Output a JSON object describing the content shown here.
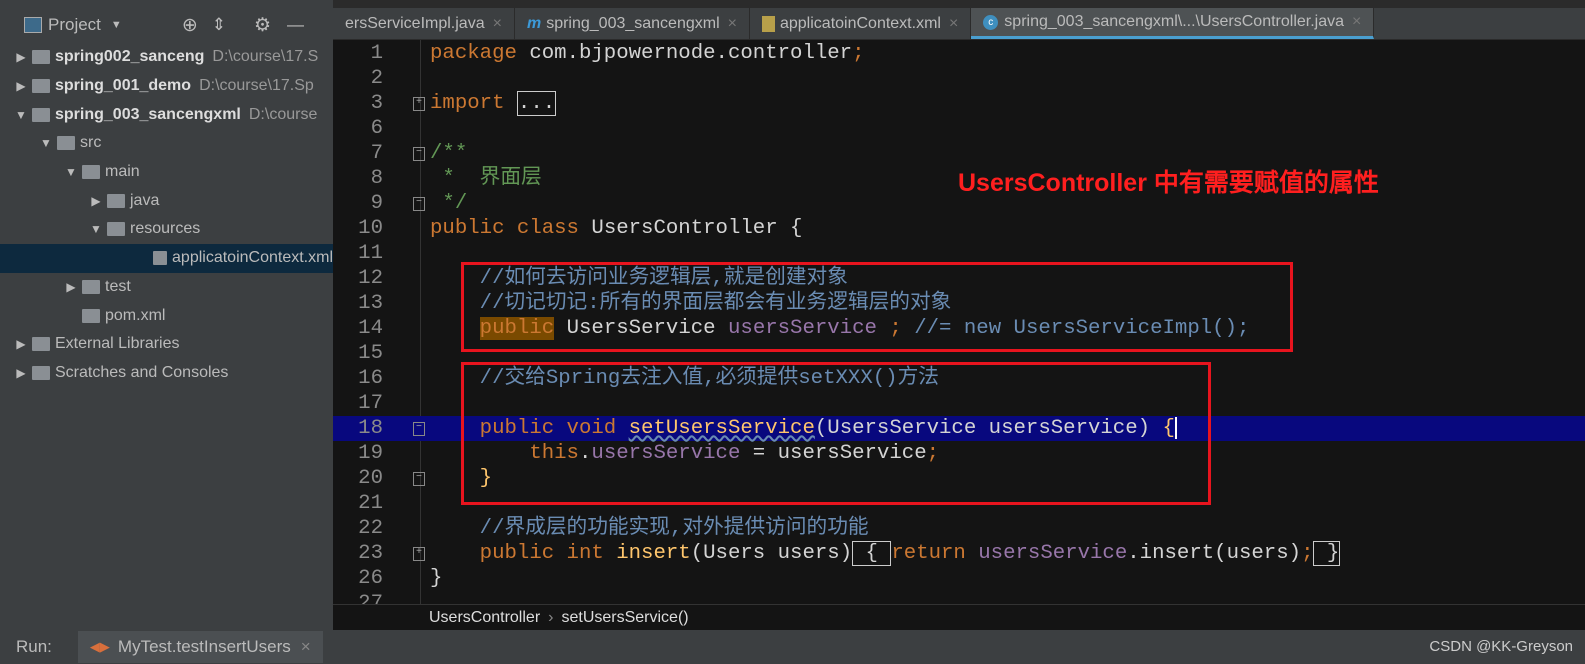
{
  "sidebar": {
    "title": "Project",
    "items": [
      {
        "arrow": "▶",
        "name": "spring002_sanceng",
        "path": "D:\\course\\17.S",
        "bold": true,
        "indent": 0
      },
      {
        "arrow": "▶",
        "name": "spring_001_demo",
        "path": "D:\\course\\17.Sp",
        "bold": true,
        "indent": 0
      },
      {
        "arrow": "▼",
        "name": "spring_003_sancengxml",
        "path": "D:\\course",
        "bold": true,
        "indent": 0
      },
      {
        "arrow": "▼",
        "name": "src",
        "path": "",
        "indent": 1
      },
      {
        "arrow": "▼",
        "name": "main",
        "path": "",
        "indent": 2
      },
      {
        "arrow": "▶",
        "name": "java",
        "path": "",
        "indent": 3
      },
      {
        "arrow": "▼",
        "name": "resources",
        "path": "",
        "indent": 3
      },
      {
        "arrow": "",
        "name": "applicatoinContext.xml",
        "path": "",
        "indent": 5,
        "selected": true
      },
      {
        "arrow": "▶",
        "name": "test",
        "path": "",
        "indent": 2
      },
      {
        "arrow": "",
        "name": "pom.xml",
        "path": "",
        "indent": 2
      },
      {
        "arrow": "▶",
        "name": "External Libraries",
        "path": "",
        "indent": 0
      },
      {
        "arrow": "▶",
        "name": "Scratches and Consoles",
        "path": "",
        "indent": 0
      }
    ]
  },
  "tabs": [
    {
      "label": "ersServiceImpl.java"
    },
    {
      "label": "spring_003_sancengxml",
      "icon": "m"
    },
    {
      "label": "applicatoinContext.xml"
    },
    {
      "label": "spring_003_sancengxml\\...\\UsersController.java",
      "icon": "c",
      "active": true
    }
  ],
  "code": [
    {
      "n": "1",
      "t": [
        [
          "package",
          "kw"
        ],
        [
          " com.bjpowernode.controller",
          "pl"
        ],
        [
          ";",
          "kw"
        ]
      ]
    },
    {
      "n": "2",
      "t": []
    },
    {
      "n": "3",
      "fold": "+",
      "t": [
        [
          "import",
          "kw"
        ],
        [
          " ",
          ""
        ],
        [
          "...",
          "pl box"
        ]
      ]
    },
    {
      "n": "6",
      "t": []
    },
    {
      "n": "7",
      "fold": "-",
      "t": [
        [
          "/**",
          "cm"
        ]
      ]
    },
    {
      "n": "8",
      "t": [
        [
          " *  界面层",
          "cm"
        ]
      ]
    },
    {
      "n": "9",
      "fold": "-",
      "t": [
        [
          " */",
          "cm"
        ]
      ]
    },
    {
      "n": "10",
      "t": [
        [
          "public class",
          "kw"
        ],
        [
          " UsersController {",
          "pl"
        ]
      ]
    },
    {
      "n": "11",
      "t": []
    },
    {
      "n": "12",
      "t": [
        [
          "    //如何去访问业务逻辑层,就是创建对象",
          "cmb"
        ]
      ]
    },
    {
      "n": "13",
      "t": [
        [
          "    //切记切记:所有的界面层都会有业务逻辑层的对象",
          "cmb"
        ]
      ]
    },
    {
      "n": "14",
      "t": [
        [
          "    ",
          ""
        ],
        [
          "public",
          "kw pubhl"
        ],
        [
          " UsersService ",
          "pl"
        ],
        [
          "usersService",
          "fld"
        ],
        [
          " ; ",
          "kw"
        ],
        [
          "//= new UsersServiceImpl();",
          "cmb"
        ]
      ]
    },
    {
      "n": "15",
      "t": []
    },
    {
      "n": "16",
      "t": [
        [
          "    //交给Spring去注入值,必须提供setXXX()方法",
          "cmb"
        ]
      ]
    },
    {
      "n": "17",
      "t": []
    },
    {
      "n": "18",
      "hl": true,
      "fold": "-",
      "t": [
        [
          "    public void ",
          "kw"
        ],
        [
          "setUsersService",
          "fn squig"
        ],
        [
          "(UsersService usersService) ",
          "pl"
        ],
        [
          "{",
          "fn"
        ]
      ]
    },
    {
      "n": "19",
      "t": [
        [
          "        this",
          "kw"
        ],
        [
          ".",
          "pl"
        ],
        [
          "usersService",
          "fld"
        ],
        [
          " = usersService",
          "pl"
        ],
        [
          ";",
          "kw"
        ]
      ]
    },
    {
      "n": "20",
      "fold": "-",
      "t": [
        [
          "    }",
          "fn"
        ]
      ]
    },
    {
      "n": "21",
      "t": []
    },
    {
      "n": "22",
      "t": [
        [
          "    //界成层的功能实现,对外提供访问的功能",
          "cmb"
        ]
      ]
    },
    {
      "n": "23",
      "fold": "+",
      "t": [
        [
          "    public int ",
          "kw"
        ],
        [
          "insert",
          "fn"
        ],
        [
          "(Users users)",
          "pl"
        ],
        [
          " { ",
          "pl box"
        ],
        [
          "return ",
          "kw"
        ],
        [
          "usersService",
          "fld"
        ],
        [
          ".insert(users)",
          "pl"
        ],
        [
          ";",
          "kw"
        ],
        [
          " }",
          "pl box"
        ]
      ]
    },
    {
      "n": "26",
      "t": [
        [
          "}",
          "pl"
        ]
      ]
    },
    {
      "n": "27",
      "t": []
    }
  ],
  "annotation": "UsersController 中有需要赋值的属性",
  "breadcrumb": {
    "class": "UsersController",
    "method": "setUsersService()"
  },
  "run": {
    "label": "Run:",
    "config": "MyTest.testInsertUsers"
  },
  "watermark": "CSDN @KK-Greyson"
}
